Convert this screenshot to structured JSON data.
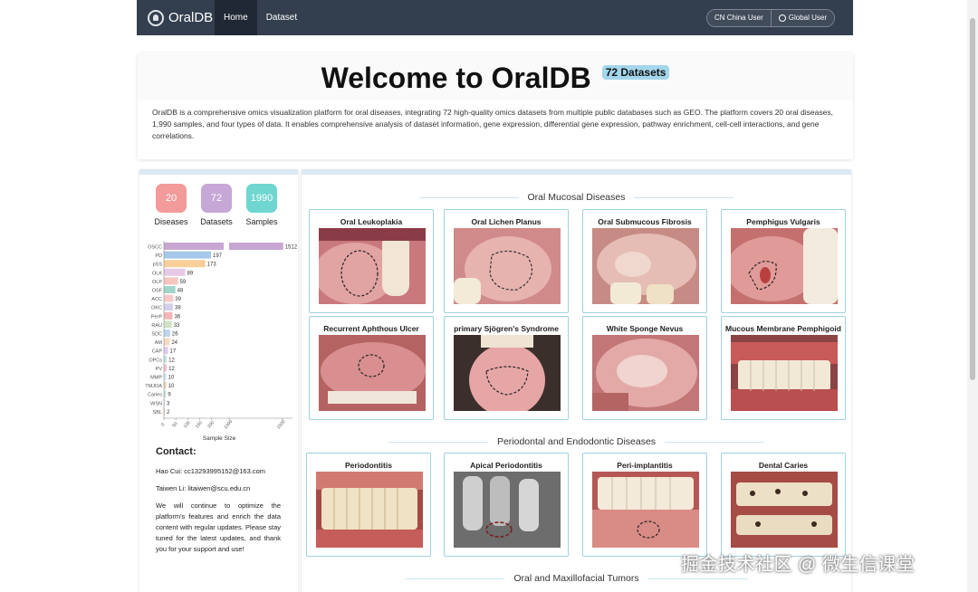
{
  "nav": {
    "brand": "OralDB",
    "items": [
      {
        "label": "Home"
      },
      {
        "label": "Dataset"
      }
    ],
    "china_user": "CN China User",
    "global_user": "Global User"
  },
  "hero": {
    "title": "Welcome to OralDB",
    "badge": "72 Datasets",
    "description": "OralDB is a comprehensive omics visualization platform for oral diseases, integrating 72 high-quality omics datasets from multiple public databases such as GEO. The platform covers 20 oral diseases, 1,990 samples, and four types of data. It enables comprehensive analysis of dataset information, gene expression, differential gene expression, pathway enrichment, cell-cell interactions, and gene correlations."
  },
  "stats": [
    {
      "value": "20",
      "label": "Diseases",
      "color": "#f39a9a"
    },
    {
      "value": "72",
      "label": "Datasets",
      "color": "#c6a7d6"
    },
    {
      "value": "1990",
      "label": "Samples",
      "color": "#6fd6d0"
    }
  ],
  "chart_data": {
    "type": "bar",
    "orientation": "horizontal",
    "categories": [
      "OSCC",
      "PD",
      "pSS",
      "OLK",
      "OLP",
      "OSF",
      "ACC",
      "OKC",
      "PerP",
      "RAU",
      "SDC",
      "AM",
      "CAP",
      "OPCs",
      "PV",
      "MMP",
      "TMJOA",
      "Caries",
      "WSN",
      "SBL"
    ],
    "values": [
      1512,
      197,
      173,
      89,
      59,
      48,
      39,
      38,
      36,
      33,
      26,
      24,
      17,
      12,
      12,
      10,
      10,
      9,
      3,
      2
    ],
    "colors": [
      "#c8a6d3",
      "#a6c8ea",
      "#f7cf98",
      "#e7c8e6",
      "#f6c6c0",
      "#9fd6c9",
      "#f5c9c9",
      "#d5d0ea",
      "#f4b6b6",
      "#cfe3c4",
      "#bcd6ee",
      "#f5d9c1",
      "#e3c9ef",
      "#c5e6e3",
      "#f2c2d2",
      "#d2e6f2",
      "#e6d6b5",
      "#cbe4d2",
      "#dcd2f0",
      "#f0c8bf"
    ],
    "xlabel": "Sample Size",
    "xticks": [
      "0",
      "50",
      "100",
      "150",
      "200",
      "1000",
      "1500"
    ],
    "x_break": [
      250,
      1000
    ]
  },
  "contact": {
    "heading": "Contact:",
    "line1": "Hao Cui: cc13293995152@163.com",
    "line2": "Taiwen Li: litaiwen@scu.edu.cn",
    "note": "We will continue to optimize the platform's features and enrich the data content with regular updates. Please stay tuned for the latest updates, and thank you for your support and use!"
  },
  "sections": [
    {
      "title": "Oral Mucosal Diseases",
      "cards": [
        {
          "name": "Oral Leukoplakia",
          "icon": "leukoplakia-photo"
        },
        {
          "name": "Oral Lichen Planus",
          "icon": "lichen-planus-photo"
        },
        {
          "name": "Oral Submucous Fibrosis",
          "icon": "fibrosis-photo"
        },
        {
          "name": "Pemphigus Vulgaris",
          "icon": "pemphigus-photo"
        },
        {
          "name": "Recurrent Aphthous Ulcer",
          "icon": "aphthous-photo"
        },
        {
          "name": "primary Sjögren's Syndrome",
          "icon": "sjogren-photo"
        },
        {
          "name": "White Sponge Nevus",
          "icon": "sponge-nevus-photo"
        },
        {
          "name": "Mucous Membrane Pemphigoid",
          "icon": "pemphigoid-photo"
        }
      ]
    },
    {
      "title": "Periodontal and Endodontic Diseases",
      "cards": [
        {
          "name": "Periodontitis",
          "icon": "periodontitis-photo"
        },
        {
          "name": "Apical Periodontitis",
          "icon": "xray-photo"
        },
        {
          "name": "Peri-implantitis",
          "icon": "implantitis-photo"
        },
        {
          "name": "Dental Caries",
          "icon": "caries-photo"
        }
      ]
    },
    {
      "title": "Oral and Maxillofacial Tumors",
      "cards": []
    }
  ],
  "watermark": "掘金技术社区 @ 微生信课堂"
}
